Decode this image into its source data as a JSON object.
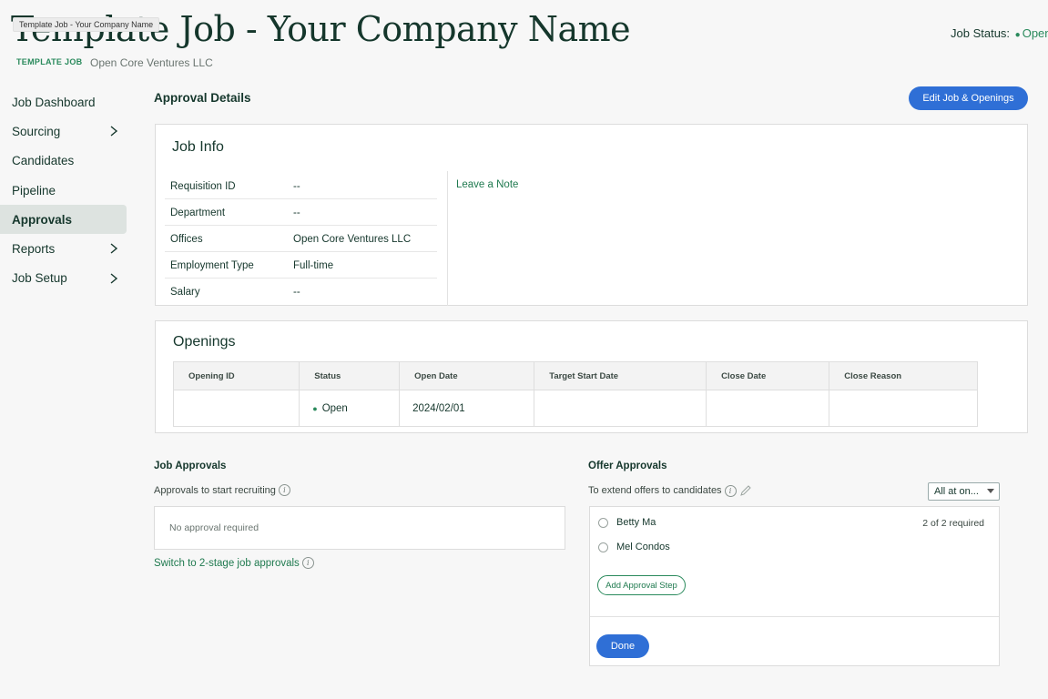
{
  "tooltip": "Template Job - Your Company Name",
  "header": {
    "title": "Template Job - Your Company Name",
    "badge": "TEMPLATE JOB",
    "company": "Open Core Ventures LLC",
    "job_status_label": "Job Status:",
    "job_status_value": "Open",
    "status_color": "#2a8a5c"
  },
  "sidebar": {
    "items": [
      {
        "label": "Job Dashboard",
        "has_chevron": false,
        "active": false
      },
      {
        "label": "Sourcing",
        "has_chevron": true,
        "active": false
      },
      {
        "label": "Candidates",
        "has_chevron": false,
        "active": false
      },
      {
        "label": "Pipeline",
        "has_chevron": false,
        "active": false
      },
      {
        "label": "Approvals",
        "has_chevron": false,
        "active": true
      },
      {
        "label": "Reports",
        "has_chevron": true,
        "active": false
      },
      {
        "label": "Job Setup",
        "has_chevron": true,
        "active": false
      }
    ]
  },
  "main": {
    "section_title": "Approval Details",
    "edit_button": "Edit Job & Openings",
    "job_info": {
      "heading": "Job Info",
      "rows": [
        {
          "label": "Requisition ID",
          "value": "--"
        },
        {
          "label": "Department",
          "value": "--"
        },
        {
          "label": "Offices",
          "value": "Open Core Ventures LLC"
        },
        {
          "label": "Employment Type",
          "value": "Full-time"
        },
        {
          "label": "Salary",
          "value": "--"
        }
      ],
      "leave_note": "Leave a Note"
    },
    "openings": {
      "heading": "Openings",
      "columns": [
        "Opening ID",
        "Status",
        "Open Date",
        "Target Start Date",
        "Close Date",
        "Close Reason"
      ],
      "rows": [
        {
          "opening_id": "",
          "status": "Open",
          "open_date": "2024/02/01",
          "target_start": "",
          "close_date": "",
          "close_reason": ""
        }
      ]
    },
    "job_approvals": {
      "heading": "Job Approvals",
      "subtext": "Approvals to start recruiting",
      "empty_text": "No approval required",
      "switch_link": "Switch to 2-stage job approvals"
    },
    "offer_approvals": {
      "heading": "Offer Approvals",
      "subtext": "To extend offers to candidates",
      "select_value": "All at on...",
      "approvers": [
        "Betty Ma",
        "Mel Condos"
      ],
      "required": "2 of 2 required",
      "add_step": "Add Approval Step",
      "done": "Done"
    }
  },
  "colors": {
    "primary_button": "#2f6fd6",
    "link_green": "#1f7a4f",
    "text_dark": "#15372c"
  }
}
